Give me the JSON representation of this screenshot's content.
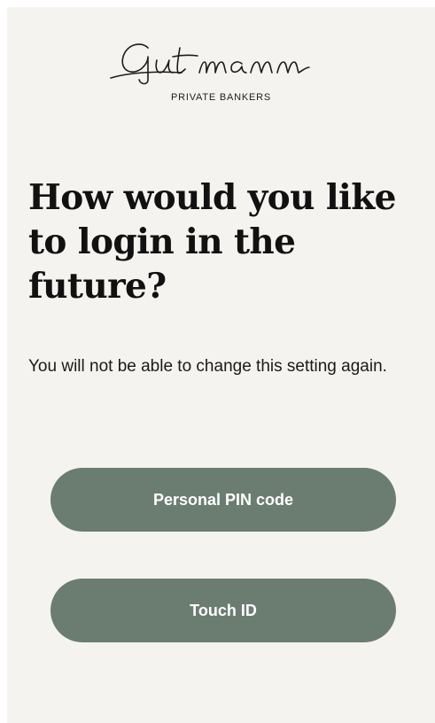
{
  "brand": {
    "name": "Gutmann",
    "tagline": "PRIVATE BANKERS"
  },
  "headline": "How would you like to login in the future?",
  "subtext": "You will not be able to change this setting again.",
  "buttons": {
    "pin_label": "Personal PIN code",
    "touch_label": "Touch ID"
  },
  "colors": {
    "background": "#f5f3ef",
    "button": "#6b7d71",
    "text": "#111111"
  }
}
